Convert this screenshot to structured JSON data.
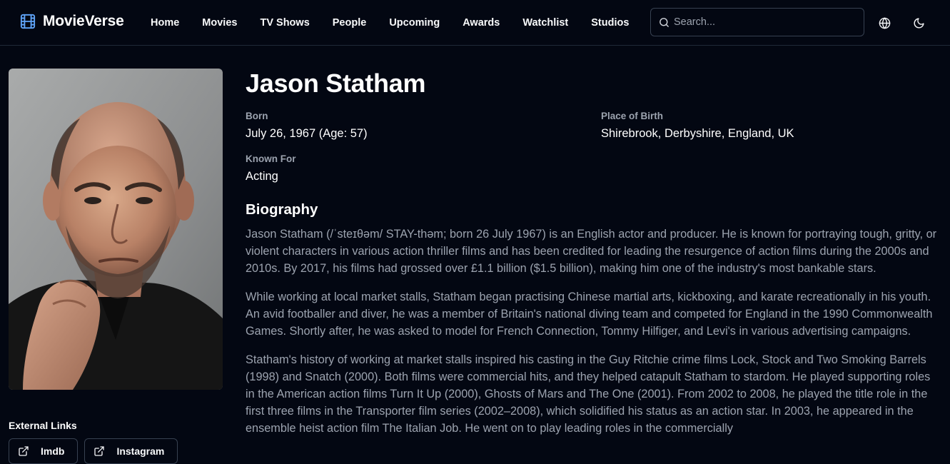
{
  "header": {
    "brand": "MovieVerse",
    "nav": [
      "Home",
      "Movies",
      "TV Shows",
      "People",
      "Upcoming",
      "Awards",
      "Watchlist",
      "Studios"
    ],
    "search_placeholder": "Search..."
  },
  "person": {
    "name": "Jason Statham",
    "facts": {
      "born_label": "Born",
      "born_value": "July 26, 1967 (Age: 57)",
      "place_label": "Place of Birth",
      "place_value": "Shirebrook, Derbyshire, England, UK",
      "known_label": "Known For",
      "known_value": "Acting"
    },
    "biography_heading": "Biography",
    "biography": [
      "Jason Statham (/ˈsteɪθəm/ STAY-thəm; born 26 July 1967) is an English actor and producer. He is known for portraying tough, gritty, or violent characters in various action thriller films and has been credited for leading the resurgence of action films during the 2000s and 2010s. By 2017, his films had grossed over £1.1 billion ($1.5 billion), making him one of the industry's most bankable stars.",
      "While working at local market stalls, Statham began practising Chinese martial arts, kickboxing, and karate recreationally in his youth. An avid footballer and diver, he was a member of Britain's national diving team and competed for England in the 1990 Commonwealth Games. Shortly after, he was asked to model for French Connection, Tommy Hilfiger, and Levi's in various advertising campaigns.",
      "Statham's history of working at market stalls inspired his casting in the Guy Ritchie crime films Lock, Stock and Two Smoking Barrels (1998) and Snatch (2000). Both films were commercial hits, and they helped catapult Statham to stardom. He played supporting roles in the American action films Turn It Up (2000), Ghosts of Mars and The One (2001). From 2002 to 2008, he played the title role in the first three films in the Transporter film series (2002–2008), which solidified his status as an action star. In 2003, he appeared in the ensemble heist action film The Italian Job. He went on to play leading roles in the commercially"
    ]
  },
  "external_links": {
    "title": "External Links",
    "links": [
      "Imdb",
      "Instagram"
    ]
  },
  "colors": {
    "background": "#030712",
    "accent": "#60a5fa",
    "muted_text": "#9ca3af",
    "border": "#374151"
  }
}
